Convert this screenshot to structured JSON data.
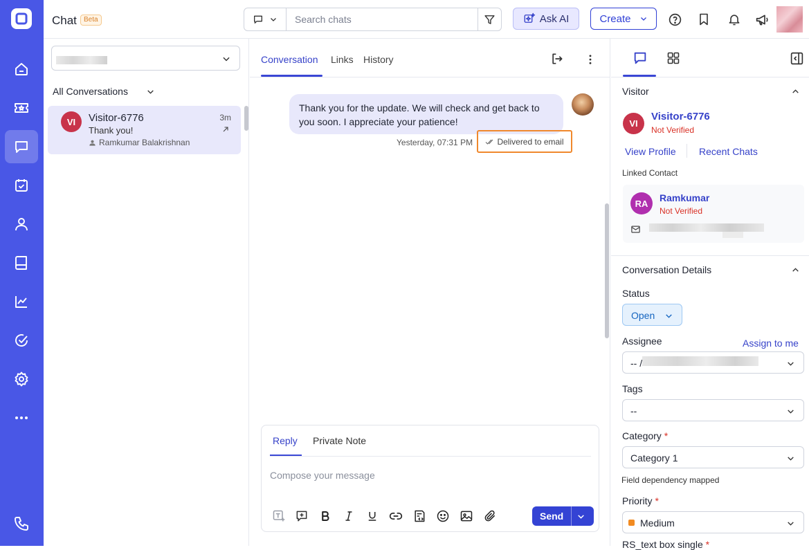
{
  "colors": {
    "rail": "#4957e6",
    "accent": "#3642c9",
    "selected_conv": "#e8e8fb",
    "highlight": "#f0882c",
    "danger": "#d93025"
  },
  "icons": {
    "rail": [
      "logo-icon",
      "home-icon",
      "ticket-icon",
      "chat-icon",
      "calendar-check-icon",
      "contact-icon",
      "book-icon",
      "chart-line-icon",
      "check-circle-icon",
      "gear-icon",
      "more-icon",
      "phone-icon"
    ],
    "top": [
      "chat-bubble-icon",
      "chevron-down-icon",
      "filter-icon",
      "sparkle-icon",
      "help-icon",
      "bookmark-icon",
      "bell-icon",
      "megaphone-icon"
    ]
  },
  "header": {
    "title": "Chat",
    "badge": "Beta",
    "search_placeholder": "Search chats",
    "ask_ai_label": "Ask AI",
    "create_label": "Create"
  },
  "conversation_list": {
    "filter_label": "All Conversations",
    "items": [
      {
        "initials": "VI",
        "name": "Visitor-6776",
        "time": "3m",
        "message": "Thank you!",
        "agent": "Ramkumar Balakrishnan"
      }
    ]
  },
  "chat": {
    "tabs": [
      "Conversation",
      "Links",
      "History"
    ],
    "active_tab": "Conversation",
    "messages": [
      {
        "text": "Thank you for the update. We will check and get back to you soon. I appreciate your patience!",
        "time": "Yesterday, 07:31 PM",
        "status": "Delivered to email"
      }
    ],
    "composer": {
      "tabs": [
        "Reply",
        "Private Note"
      ],
      "active_tab": "Reply",
      "placeholder": "Compose your message",
      "send_label": "Send"
    }
  },
  "sidebar": {
    "visitor_title": "Visitor",
    "visitor": {
      "initials": "VI",
      "name": "Visitor-6776",
      "verification": "Not Verified"
    },
    "view_profile": "View Profile",
    "recent_chats": "Recent Chats",
    "linked_contact_label": "Linked Contact",
    "contact": {
      "initials": "RA",
      "name": "Ramkumar",
      "verification": "Not Verified"
    },
    "details_title": "Conversation Details",
    "status_label": "Status",
    "status_value": "Open",
    "assignee_label": "Assignee",
    "assign_to_me": "Assign to me",
    "assignee_value": "-- /",
    "tags_label": "Tags",
    "tags_value": "--",
    "category_label": "Category",
    "category_value": "Category 1",
    "category_note": "Field dependency mapped",
    "priority_label": "Priority",
    "priority_value": "Medium",
    "next_field_label": "RS_text box single"
  }
}
